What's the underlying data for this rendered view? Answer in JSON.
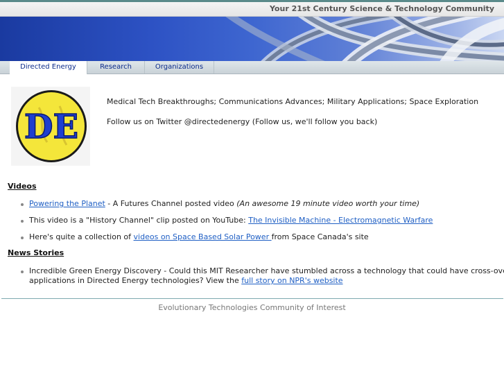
{
  "header": {
    "tagline": "Your 21st Century Science & Technology Community"
  },
  "nav": {
    "items": [
      {
        "label": "Directed Energy"
      },
      {
        "label": "Research"
      },
      {
        "label": "Organizations"
      }
    ]
  },
  "logo": {
    "text": "DE"
  },
  "intro": {
    "line1": "Medical Tech Breakthroughs; Communications Advances; Military Applications; Space Exploration",
    "line2": "Follow us on Twitter @directedenergy (Follow us, we'll follow you back)"
  },
  "videos": {
    "heading": "Videos",
    "items": [
      {
        "link": "Powering the Planet",
        "text": " - A Futures Channel posted video ",
        "italic": "(An awesome 19 minute video worth your time)"
      },
      {
        "text": "This video is a \"History Channel\" clip posted on YouTube: ",
        "link": "The Invisible Machine - Electromagnetic Warfare"
      },
      {
        "text": "Here's quite a collection of ",
        "link": "videos on Space Based Solar Power ",
        "suffix": "from Space Canada's site"
      }
    ]
  },
  "news": {
    "heading": "News Stories",
    "items": [
      {
        "text": "Incredible Green Energy Discovery - Could this MIT Researcher have stumbled across a technology that could have cross-over",
        "text2": "applications in Directed Energy technologies?  View the ",
        "link": "full story on NPR's website"
      }
    ]
  },
  "footer": {
    "text": "Evolutionary Technologies Community of Interest"
  }
}
